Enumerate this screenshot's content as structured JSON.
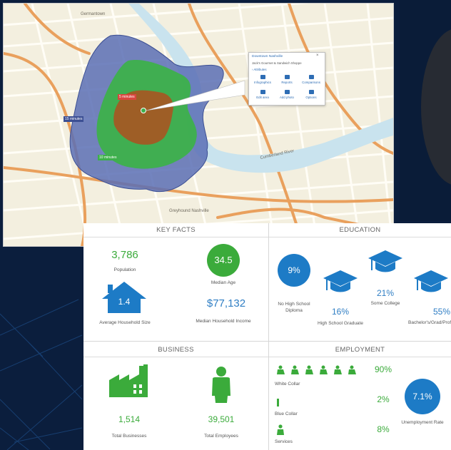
{
  "map": {
    "place_labels": {
      "germantown": "Germantown",
      "cumberland_river": "Cumberland River",
      "greyhound": "Greyhound Nashville"
    },
    "ring_labels": {
      "inner": "5 minutes",
      "middle": "10 minutes",
      "outer": "15 minutes"
    },
    "popup": {
      "title": "Downtown Nashville",
      "subtitle": "Jack's Gourmet & Sandwich Shoppe",
      "attributes_link": "Attributes",
      "buttons": [
        "Infographics",
        "Reports",
        "Comparisons",
        "Edit area",
        "Add photo",
        "Options"
      ]
    }
  },
  "key_facts": {
    "heading": "KEY FACTS",
    "population_value": "3,786",
    "population_label": "Population",
    "median_age_value": "34.5",
    "median_age_label": "Median Age",
    "household_size_value": "1.4",
    "household_size_label": "Average Household Size",
    "median_income_value": "$77,132",
    "median_income_label": "Median Household Income"
  },
  "education": {
    "heading": "EDUCATION",
    "no_hs_value": "9%",
    "no_hs_label": "No High School Diploma",
    "hs_value": "16%",
    "hs_label": "High School Graduate",
    "some_college_value": "21%",
    "some_college_label": "Some College",
    "bachelors_value": "55%",
    "bachelors_label": "Bachelor's/Grad/Prof Degree"
  },
  "business": {
    "heading": "BUSINESS",
    "total_businesses_value": "1,514",
    "total_businesses_label": "Total Businesses",
    "total_employees_value": "39,501",
    "total_employees_label": "Total Employees"
  },
  "employment": {
    "heading": "EMPLOYMENT",
    "white_collar_value": "90%",
    "white_collar_label": "White Collar",
    "blue_collar_value": "2%",
    "blue_collar_label": "Blue Collar",
    "services_value": "8%",
    "services_label": "Services",
    "unemployment_value": "7.1%",
    "unemployment_label": "Unemployment Rate"
  },
  "colors": {
    "green": "#3bab3b",
    "blue": "#1d7bc6",
    "ring_outer": "#5a6fb5",
    "ring_middle": "#3db04b",
    "ring_inner": "#a35a24",
    "background": "#0b1e3d"
  }
}
